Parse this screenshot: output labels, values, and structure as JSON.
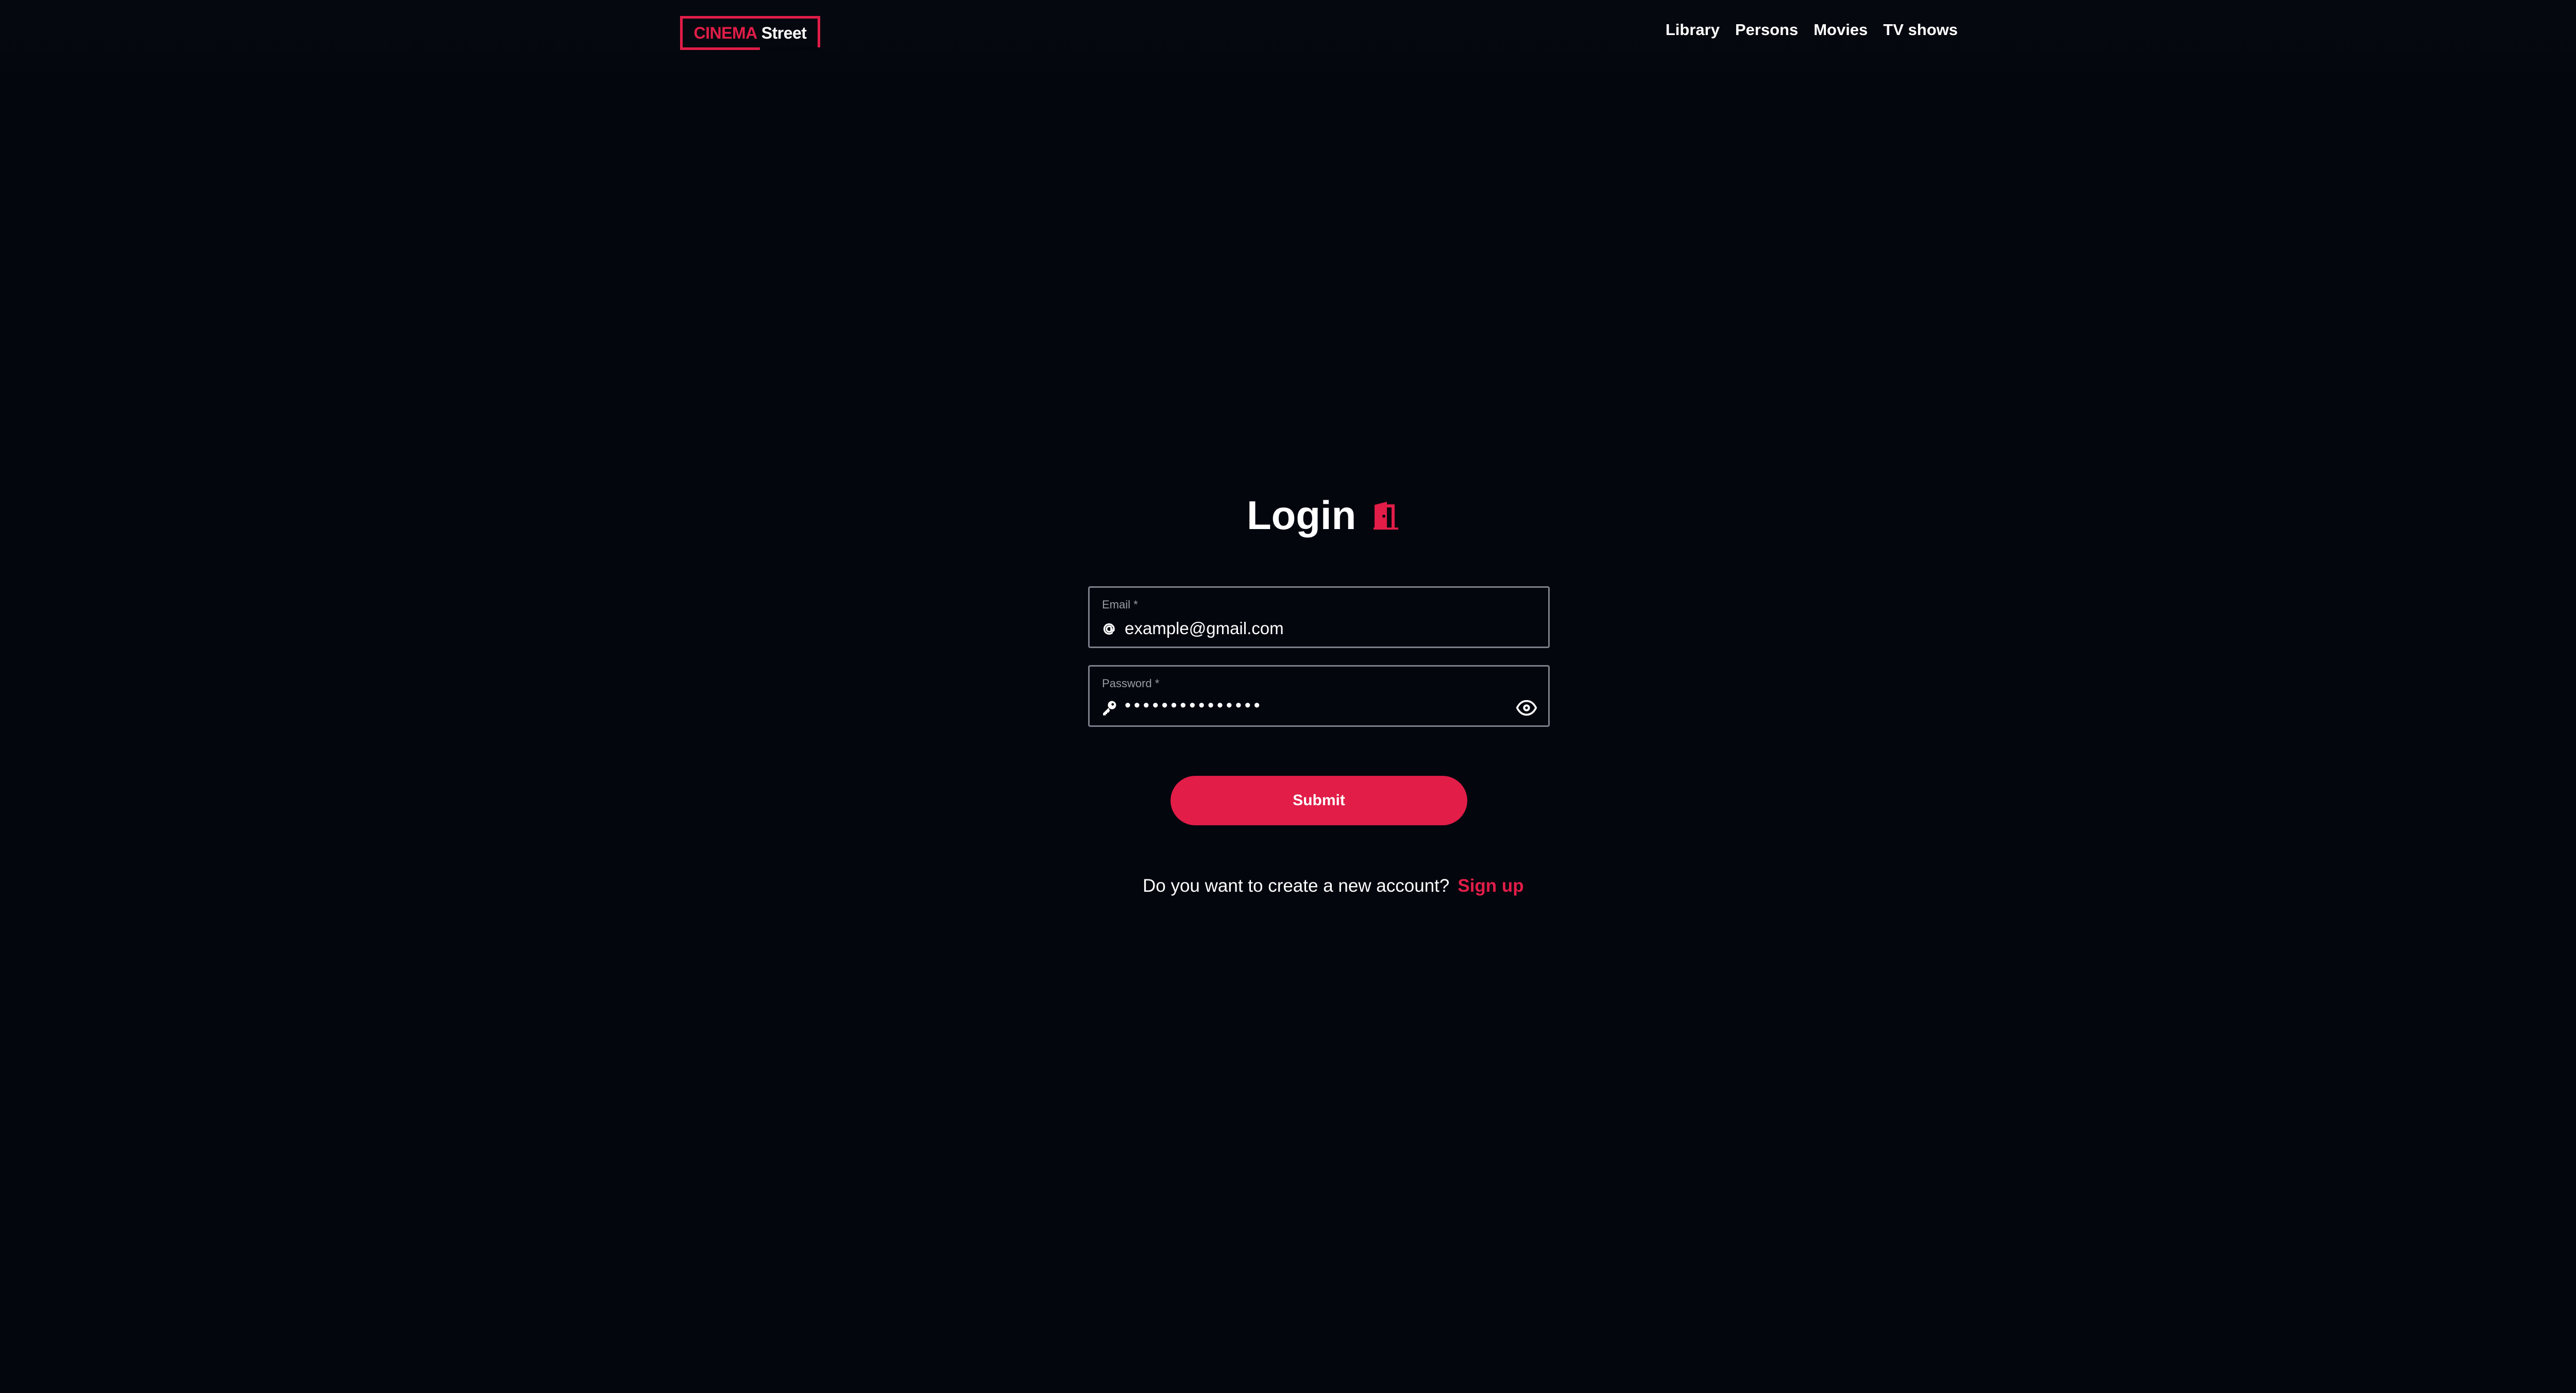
{
  "brand": {
    "logo_part1": "CINEMA",
    "logo_part2": "Street",
    "accent": "#e11d48"
  },
  "nav": {
    "items": [
      "Library",
      "Persons",
      "Movies",
      "TV shows"
    ]
  },
  "login": {
    "title": "Login",
    "title_icon": "door-icon"
  },
  "form": {
    "email": {
      "label": "Email *",
      "value": "example@gmail.com",
      "icon": "at-icon"
    },
    "password": {
      "label": "Password *",
      "masked_value": "•••••••••••••••",
      "icon": "key-icon",
      "toggle_icon": "eye-icon"
    },
    "submit_label": "Submit"
  },
  "signup": {
    "prompt": "Do you want to create a new account?",
    "link": "Sign up"
  }
}
